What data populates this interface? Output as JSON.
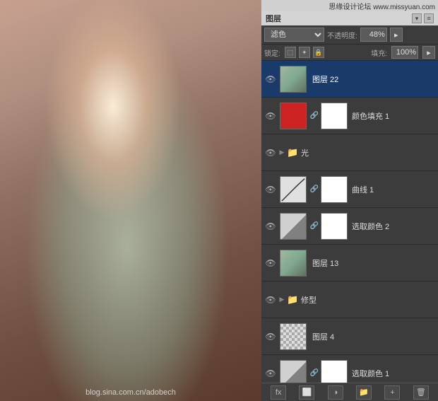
{
  "watermark": {
    "top": "思缘设计论坛 www.missyuan.com",
    "bottom": "blog.sina.com.cn/adobech"
  },
  "layers_panel": {
    "title": "图层",
    "blend_mode": "滤色",
    "opacity_label": "不透明度:",
    "opacity_value": "48%",
    "lock_label": "锁定:",
    "fill_label": "填充:",
    "fill_value": "100%",
    "layers": [
      {
        "id": "layer22",
        "name": "图层 22",
        "visible": true,
        "active": true,
        "type": "raster",
        "has_mask": false
      },
      {
        "id": "color_fill1",
        "name": "颜色填充 1",
        "visible": true,
        "active": false,
        "type": "solid_color",
        "has_mask": true
      },
      {
        "id": "group_light",
        "name": "光",
        "visible": true,
        "active": false,
        "type": "group",
        "has_mask": false
      },
      {
        "id": "curves1",
        "name": "曲线 1",
        "visible": true,
        "active": false,
        "type": "curves",
        "has_mask": true
      },
      {
        "id": "selective2",
        "name": "选取颜色 2",
        "visible": true,
        "active": false,
        "type": "selective_color",
        "has_mask": true
      },
      {
        "id": "layer13",
        "name": "图层 13",
        "visible": true,
        "active": false,
        "type": "raster",
        "has_mask": false
      },
      {
        "id": "group_xiutype",
        "name": "修型",
        "visible": true,
        "active": false,
        "type": "group",
        "has_mask": false
      },
      {
        "id": "layer4",
        "name": "图层 4",
        "visible": true,
        "active": false,
        "type": "raster_transparent",
        "has_mask": false
      },
      {
        "id": "selective1",
        "name": "选取颜色 1",
        "visible": true,
        "active": false,
        "type": "selective_color",
        "has_mask": true
      }
    ],
    "toolbar_buttons": [
      "fx",
      "mask",
      "adjustment",
      "group",
      "new",
      "delete"
    ]
  }
}
